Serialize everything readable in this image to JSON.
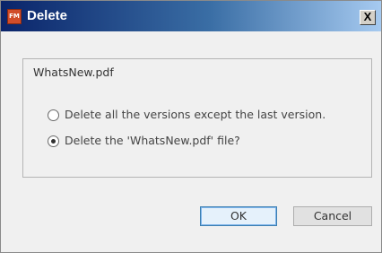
{
  "dialog": {
    "title": "Delete",
    "app_icon_text": "FM",
    "close_label": "X",
    "file_name": "WhatsNew.pdf",
    "options": [
      {
        "label": "Delete all the versions except the last version.",
        "selected": false
      },
      {
        "label": "Delete the 'WhatsNew.pdf'  file?",
        "selected": true
      }
    ],
    "ok_label": "OK",
    "cancel_label": "Cancel"
  },
  "colors": {
    "title_gradient_start": "#0a246a",
    "title_gradient_end": "#a6caf0",
    "dialog_background": "#f0f0f0",
    "app_icon": "#d14d2a"
  },
  "icons": {
    "app": "app-icon",
    "close": "close-icon"
  }
}
